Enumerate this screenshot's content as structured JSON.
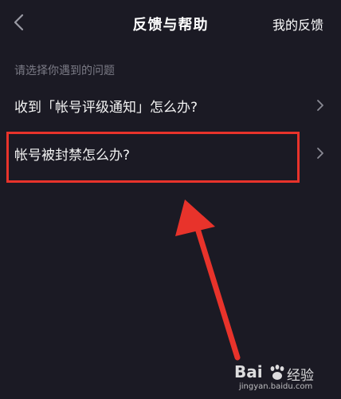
{
  "header": {
    "title": "反馈与帮助",
    "my_feedback": "我的反馈"
  },
  "section": {
    "hint": "请选择你遇到的问题"
  },
  "items": [
    {
      "label": "收到「帐号评级通知」怎么办?"
    },
    {
      "label": "帐号被封禁怎么办?"
    }
  ],
  "colors": {
    "background": "#1b1a24",
    "highlight": "#e8332b",
    "hint_text": "#7b7b86"
  },
  "watermark": {
    "brand": "Bai",
    "product": "经验",
    "domain": "jingyan.baidu.com"
  }
}
